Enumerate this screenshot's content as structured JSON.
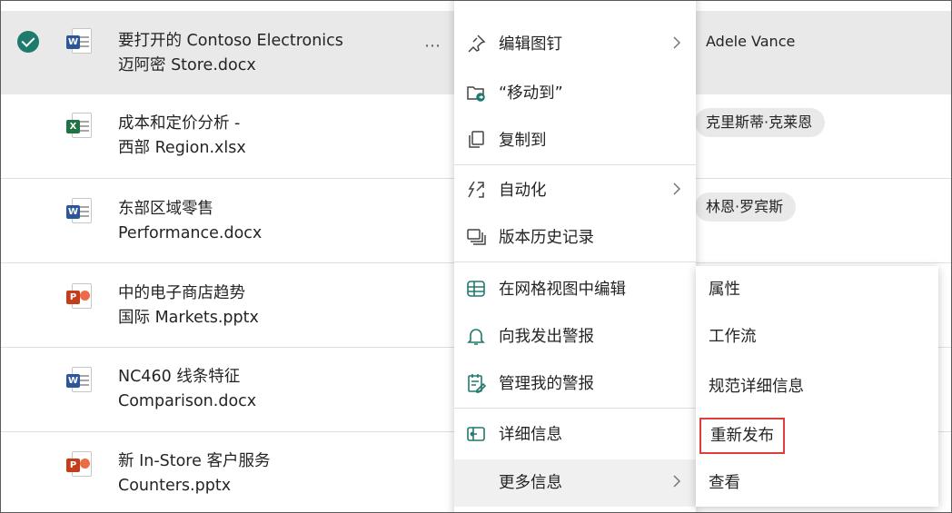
{
  "files": [
    {
      "name_line1": "要打开的 Contoso Electronics",
      "name_line2": "迈阿密 Store.docx",
      "type": "word",
      "badge": "W",
      "owner": "Adele Vance",
      "selected": true
    },
    {
      "name_line1": "成本和定价分析 -",
      "name_line2": "西部 Region.xlsx",
      "type": "excel",
      "badge": "X",
      "owner": "克里斯蒂·克莱恩"
    },
    {
      "name_line1": "东部区域零售",
      "name_line2": "Performance.docx",
      "type": "word",
      "badge": "W",
      "owner": "林恩·罗宾斯"
    },
    {
      "name_line1": "中的电子商店趋势",
      "name_line2": "国际 Markets.pptx",
      "type": "ppt",
      "badge": "P",
      "owner": ""
    },
    {
      "name_line1": "NC460 线条特征",
      "name_line2": "Comparison.docx",
      "type": "word",
      "badge": "W",
      "owner": ""
    },
    {
      "name_line1": "新 In-Store 客户服务",
      "name_line2": "Counters.pptx",
      "type": "ppt",
      "badge": "P",
      "owner": ""
    }
  ],
  "row_actions": {
    "more_glyph": "⋯"
  },
  "context_menu": {
    "items": [
      {
        "label": "编辑图钉",
        "icon": "pin-icon",
        "has_submenu": true
      },
      {
        "label": "“移动到”",
        "icon": "move-folder-icon"
      },
      {
        "label": "复制到",
        "icon": "copy-icon"
      },
      {
        "label": "自动化",
        "icon": "automate-icon",
        "has_submenu": true
      },
      {
        "label": "版本历史记录",
        "icon": "version-history-icon"
      },
      {
        "label": "在网格视图中编辑",
        "icon": "grid-icon"
      },
      {
        "label": "向我发出警报",
        "icon": "bell-icon"
      },
      {
        "label": "管理我的警报",
        "icon": "manage-alerts-icon"
      },
      {
        "label": "详细信息",
        "icon": "details-icon"
      },
      {
        "label": "更多信息",
        "has_submenu": true
      }
    ]
  },
  "submenu": {
    "items": [
      {
        "label": "属性"
      },
      {
        "label": "工作流"
      },
      {
        "label": "规范详细信息"
      },
      {
        "label": "重新发布",
        "highlighted": true
      },
      {
        "label": "查看"
      }
    ]
  },
  "colors": {
    "accent": "#1f7a6e",
    "highlight_border": "#e03c3c",
    "selected_row": "#e9e9e9"
  }
}
